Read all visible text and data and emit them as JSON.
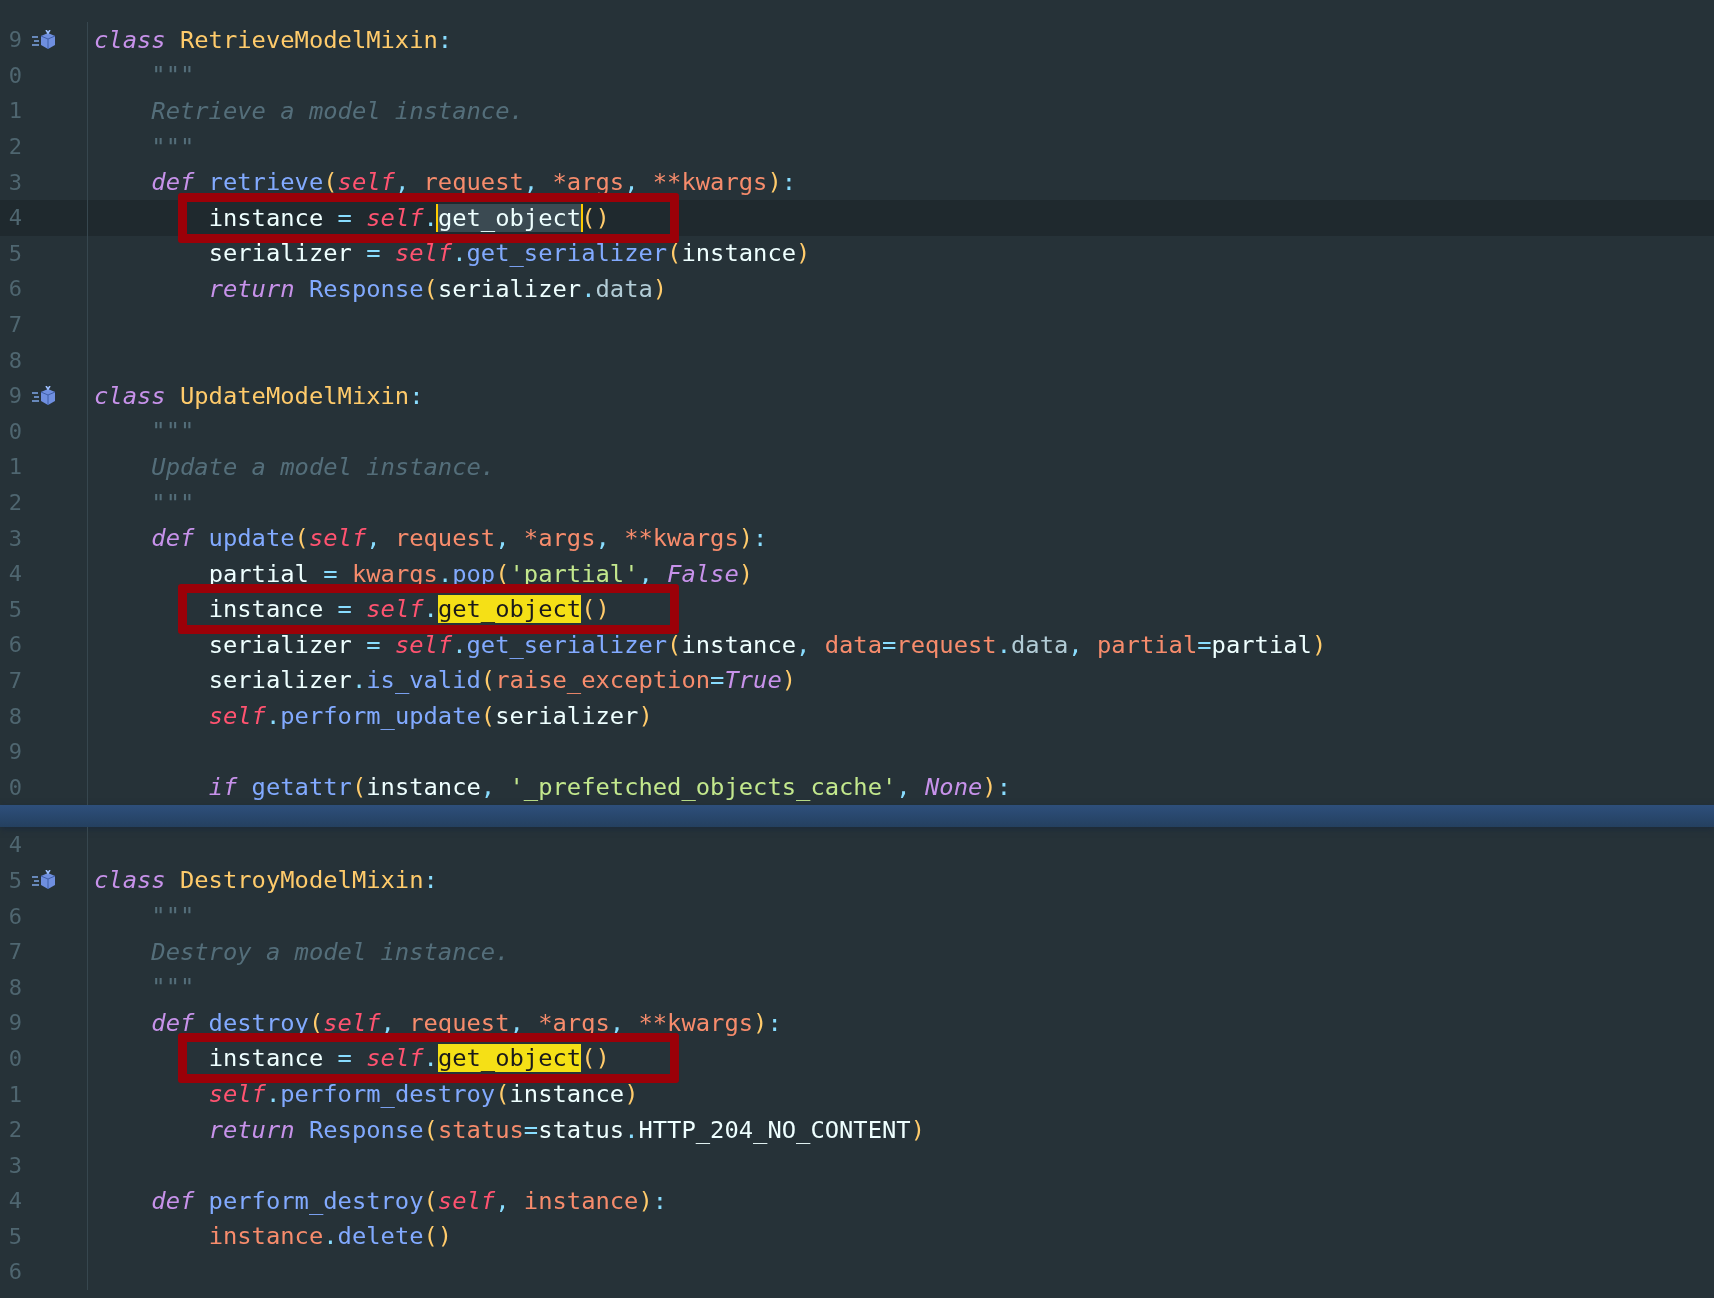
{
  "sections": [
    {
      "lines": [
        {
          "number": "9",
          "marker": true,
          "tokens": [
            {
              "text": "class",
              "kind": "keyword"
            },
            {
              "text": " RetrieveModelMixin",
              "kind": "classname"
            },
            {
              "text": ":",
              "kind": "punct"
            }
          ]
        },
        {
          "number": "0",
          "tokens": [
            {
              "text": "    \"\"\"",
              "kind": "doc"
            }
          ]
        },
        {
          "number": "1",
          "tokens": [
            {
              "text": "    Retrieve a model instance.",
              "kind": "doc"
            }
          ]
        },
        {
          "number": "2",
          "tokens": [
            {
              "text": "    \"\"\"",
              "kind": "doc"
            }
          ]
        },
        {
          "number": "3",
          "tokens": [
            {
              "text": "    def",
              "kind": "keyword"
            },
            {
              "text": " retrieve",
              "kind": "function"
            },
            {
              "text": "(",
              "kind": "paren"
            },
            {
              "text": "self",
              "kind": "self"
            },
            {
              "text": ",",
              "kind": "punct"
            },
            {
              "text": " request",
              "kind": "param"
            },
            {
              "text": ",",
              "kind": "punct"
            },
            {
              "text": " *args",
              "kind": "param"
            },
            {
              "text": ",",
              "kind": "punct"
            },
            {
              "text": " **kwargs",
              "kind": "param"
            },
            {
              "text": ")",
              "kind": "paren"
            },
            {
              "text": ":",
              "kind": "punct"
            }
          ]
        },
        {
          "number": "4",
          "current": true,
          "boxed": true,
          "tokens": [
            {
              "text": "        instance ",
              "kind": "plain"
            },
            {
              "text": "=",
              "kind": "punct"
            },
            {
              "text": " self",
              "kind": "self"
            },
            {
              "text": ".",
              "kind": "punct"
            },
            {
              "text": "get_object",
              "kind": "selection"
            },
            {
              "text": "()",
              "kind": "paren"
            }
          ]
        },
        {
          "number": "5",
          "tokens": [
            {
              "text": "        serializer ",
              "kind": "plain"
            },
            {
              "text": "=",
              "kind": "punct"
            },
            {
              "text": " self",
              "kind": "self"
            },
            {
              "text": ".",
              "kind": "punct"
            },
            {
              "text": "get_serializer",
              "kind": "function"
            },
            {
              "text": "(",
              "kind": "paren"
            },
            {
              "text": "instance",
              "kind": "plain"
            },
            {
              "text": ")",
              "kind": "paren"
            }
          ]
        },
        {
          "number": "6",
          "tokens": [
            {
              "text": "        return",
              "kind": "keyword"
            },
            {
              "text": " Response",
              "kind": "function"
            },
            {
              "text": "(",
              "kind": "paren"
            },
            {
              "text": "serializer",
              "kind": "plain"
            },
            {
              "text": ".",
              "kind": "punct"
            },
            {
              "text": "data",
              "kind": "attr"
            },
            {
              "text": ")",
              "kind": "paren"
            }
          ]
        },
        {
          "number": "7"
        },
        {
          "number": "8"
        },
        {
          "number": "9",
          "marker": true,
          "tokens": [
            {
              "text": "class",
              "kind": "keyword"
            },
            {
              "text": " UpdateModelMixin",
              "kind": "classname"
            },
            {
              "text": ":",
              "kind": "punct"
            }
          ]
        },
        {
          "number": "0",
          "tokens": [
            {
              "text": "    \"\"\"",
              "kind": "doc"
            }
          ]
        },
        {
          "number": "1",
          "tokens": [
            {
              "text": "    Update a model instance.",
              "kind": "doc"
            }
          ]
        },
        {
          "number": "2",
          "tokens": [
            {
              "text": "    \"\"\"",
              "kind": "doc"
            }
          ]
        },
        {
          "number": "3",
          "tokens": [
            {
              "text": "    def",
              "kind": "keyword"
            },
            {
              "text": " update",
              "kind": "function"
            },
            {
              "text": "(",
              "kind": "paren"
            },
            {
              "text": "self",
              "kind": "self"
            },
            {
              "text": ",",
              "kind": "punct"
            },
            {
              "text": " request",
              "kind": "param"
            },
            {
              "text": ",",
              "kind": "punct"
            },
            {
              "text": " *args",
              "kind": "param"
            },
            {
              "text": ",",
              "kind": "punct"
            },
            {
              "text": " **kwargs",
              "kind": "param"
            },
            {
              "text": ")",
              "kind": "paren"
            },
            {
              "text": ":",
              "kind": "punct"
            }
          ]
        },
        {
          "number": "4",
          "tokens": [
            {
              "text": "        partial ",
              "kind": "plain"
            },
            {
              "text": "=",
              "kind": "punct"
            },
            {
              "text": " kwargs",
              "kind": "param"
            },
            {
              "text": ".",
              "kind": "punct"
            },
            {
              "text": "pop",
              "kind": "function"
            },
            {
              "text": "(",
              "kind": "paren"
            },
            {
              "text": "'partial'",
              "kind": "string"
            },
            {
              "text": ",",
              "kind": "punct"
            },
            {
              "text": " False",
              "kind": "constant"
            },
            {
              "text": ")",
              "kind": "paren"
            }
          ]
        },
        {
          "number": "5",
          "boxed": true,
          "tokens": [
            {
              "text": "        instance ",
              "kind": "plain"
            },
            {
              "text": "=",
              "kind": "punct"
            },
            {
              "text": " self",
              "kind": "self"
            },
            {
              "text": ".",
              "kind": "punct"
            },
            {
              "text": "get_object",
              "kind": "match"
            },
            {
              "text": "()",
              "kind": "paren"
            }
          ]
        },
        {
          "number": "6",
          "tokens": [
            {
              "text": "        serializer ",
              "kind": "plain"
            },
            {
              "text": "=",
              "kind": "punct"
            },
            {
              "text": " self",
              "kind": "self"
            },
            {
              "text": ".",
              "kind": "punct"
            },
            {
              "text": "get_serializer",
              "kind": "function"
            },
            {
              "text": "(",
              "kind": "paren"
            },
            {
              "text": "instance",
              "kind": "plain"
            },
            {
              "text": ",",
              "kind": "punct"
            },
            {
              "text": " data",
              "kind": "param"
            },
            {
              "text": "=",
              "kind": "punct"
            },
            {
              "text": "request",
              "kind": "param"
            },
            {
              "text": ".",
              "kind": "punct"
            },
            {
              "text": "data",
              "kind": "attr"
            },
            {
              "text": ",",
              "kind": "punct"
            },
            {
              "text": " partial",
              "kind": "param"
            },
            {
              "text": "=",
              "kind": "punct"
            },
            {
              "text": "partial",
              "kind": "plain"
            },
            {
              "text": ")",
              "kind": "paren"
            }
          ]
        },
        {
          "number": "7",
          "tokens": [
            {
              "text": "        serializer",
              "kind": "plain"
            },
            {
              "text": ".",
              "kind": "punct"
            },
            {
              "text": "is_valid",
              "kind": "function"
            },
            {
              "text": "(",
              "kind": "paren"
            },
            {
              "text": "raise_exception",
              "kind": "param"
            },
            {
              "text": "=",
              "kind": "punct"
            },
            {
              "text": "True",
              "kind": "constant"
            },
            {
              "text": ")",
              "kind": "paren"
            }
          ]
        },
        {
          "number": "8",
          "tokens": [
            {
              "text": "        self",
              "kind": "self"
            },
            {
              "text": ".",
              "kind": "punct"
            },
            {
              "text": "perform_update",
              "kind": "function"
            },
            {
              "text": "(",
              "kind": "paren"
            },
            {
              "text": "serializer",
              "kind": "plain"
            },
            {
              "text": ")",
              "kind": "paren"
            }
          ]
        },
        {
          "number": "9"
        },
        {
          "number": "0",
          "tokens": [
            {
              "text": "        if",
              "kind": "keyword"
            },
            {
              "text": " getattr",
              "kind": "function"
            },
            {
              "text": "(",
              "kind": "paren"
            },
            {
              "text": "instance",
              "kind": "plain"
            },
            {
              "text": ",",
              "kind": "punct"
            },
            {
              "text": " '_prefetched_objects_cache'",
              "kind": "string"
            },
            {
              "text": ",",
              "kind": "punct"
            },
            {
              "text": " None",
              "kind": "constant"
            },
            {
              "text": ")",
              "kind": "paren"
            },
            {
              "text": ":",
              "kind": "punct"
            }
          ]
        }
      ]
    },
    {
      "lines": [
        {
          "number": "4"
        },
        {
          "number": "5",
          "marker": true,
          "tokens": [
            {
              "text": "class",
              "kind": "keyword"
            },
            {
              "text": " DestroyModelMixin",
              "kind": "classname"
            },
            {
              "text": ":",
              "kind": "punct"
            }
          ]
        },
        {
          "number": "6",
          "tokens": [
            {
              "text": "    \"\"\"",
              "kind": "doc"
            }
          ]
        },
        {
          "number": "7",
          "tokens": [
            {
              "text": "    Destroy a model instance.",
              "kind": "doc"
            }
          ]
        },
        {
          "number": "8",
          "tokens": [
            {
              "text": "    \"\"\"",
              "kind": "doc"
            }
          ]
        },
        {
          "number": "9",
          "tokens": [
            {
              "text": "    def",
              "kind": "keyword"
            },
            {
              "text": " destroy",
              "kind": "function"
            },
            {
              "text": "(",
              "kind": "paren"
            },
            {
              "text": "self",
              "kind": "self"
            },
            {
              "text": ",",
              "kind": "punct"
            },
            {
              "text": " request",
              "kind": "param"
            },
            {
              "text": ",",
              "kind": "punct"
            },
            {
              "text": " *args",
              "kind": "param"
            },
            {
              "text": ",",
              "kind": "punct"
            },
            {
              "text": " **kwargs",
              "kind": "param"
            },
            {
              "text": ")",
              "kind": "paren"
            },
            {
              "text": ":",
              "kind": "punct"
            }
          ]
        },
        {
          "number": "0",
          "boxed": true,
          "tokens": [
            {
              "text": "        instance ",
              "kind": "plain"
            },
            {
              "text": "=",
              "kind": "punct"
            },
            {
              "text": " self",
              "kind": "self"
            },
            {
              "text": ".",
              "kind": "punct"
            },
            {
              "text": "get_object",
              "kind": "match"
            },
            {
              "text": "()",
              "kind": "paren"
            }
          ]
        },
        {
          "number": "1",
          "tokens": [
            {
              "text": "        self",
              "kind": "self"
            },
            {
              "text": ".",
              "kind": "punct"
            },
            {
              "text": "perform_destroy",
              "kind": "function"
            },
            {
              "text": "(",
              "kind": "paren"
            },
            {
              "text": "instance",
              "kind": "plain"
            },
            {
              "text": ")",
              "kind": "paren"
            }
          ]
        },
        {
          "number": "2",
          "tokens": [
            {
              "text": "        return",
              "kind": "keyword"
            },
            {
              "text": " Response",
              "kind": "function"
            },
            {
              "text": "(",
              "kind": "paren"
            },
            {
              "text": "status",
              "kind": "param"
            },
            {
              "text": "=",
              "kind": "punct"
            },
            {
              "text": "status",
              "kind": "plain"
            },
            {
              "text": ".",
              "kind": "punct"
            },
            {
              "text": "HTTP_204_NO_CONTENT",
              "kind": "plain"
            },
            {
              "text": ")",
              "kind": "paren"
            }
          ]
        },
        {
          "number": "3"
        },
        {
          "number": "4",
          "tokens": [
            {
              "text": "    def",
              "kind": "keyword"
            },
            {
              "text": " perform_destroy",
              "kind": "function"
            },
            {
              "text": "(",
              "kind": "paren"
            },
            {
              "text": "self",
              "kind": "self"
            },
            {
              "text": ",",
              "kind": "punct"
            },
            {
              "text": " instance",
              "kind": "param"
            },
            {
              "text": ")",
              "kind": "paren"
            },
            {
              "text": ":",
              "kind": "punct"
            }
          ]
        },
        {
          "number": "5",
          "tokens": [
            {
              "text": "        instance",
              "kind": "param"
            },
            {
              "text": ".",
              "kind": "punct"
            },
            {
              "text": "delete",
              "kind": "function"
            },
            {
              "text": "()",
              "kind": "paren"
            }
          ]
        },
        {
          "number": "6"
        }
      ]
    }
  ]
}
